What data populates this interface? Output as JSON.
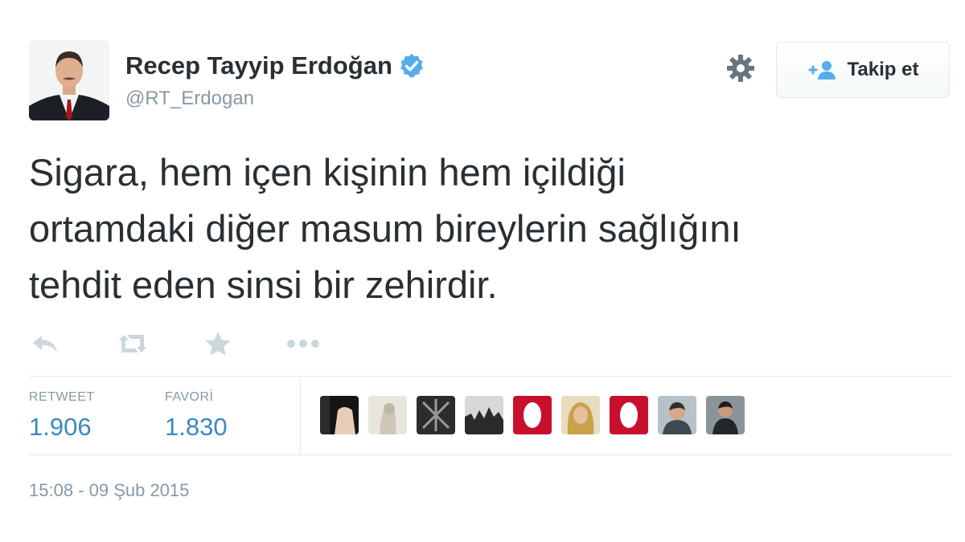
{
  "author": {
    "display_name": "Recep Tayyip Erdoğan",
    "handle": "@RT_Erdogan",
    "verified_icon": "verified-badge-icon",
    "avatar_icon": "profile-photo"
  },
  "header_actions": {
    "settings_icon": "gear-icon",
    "follow_label": "Takip et",
    "follow_icon": "add-user-icon"
  },
  "tweet": {
    "text_line_1": "Sigara, hem içen kişinin hem içildiği",
    "text_line_2": "ortamdaki diğer masum bireylerin sağlığını",
    "text_line_3": "tehdit eden sinsi bir zehirdir."
  },
  "action_icons": [
    "reply-icon",
    "retweet-icon",
    "favorite-star-icon",
    "more-dots-icon"
  ],
  "stats": {
    "retweet_label": "RETWEET",
    "retweet_count": "1.906",
    "favorite_label": "FAVORİ",
    "favorite_count": "1.830"
  },
  "favoriter_avatars": [
    "favoriter-avatar-1",
    "favoriter-avatar-2",
    "favoriter-avatar-3",
    "favoriter-avatar-4",
    "favoriter-avatar-5",
    "favoriter-avatar-6",
    "favoriter-avatar-7",
    "favoriter-avatar-8",
    "favoriter-avatar-9"
  ],
  "timestamp": "15:08 - 09 Şub 2015",
  "colors": {
    "link_blue": "#3b88c3",
    "verified_blue": "#55acee",
    "muted_grey": "#8899a6",
    "text_dark": "#292f33",
    "border": "#e1e8ed"
  }
}
